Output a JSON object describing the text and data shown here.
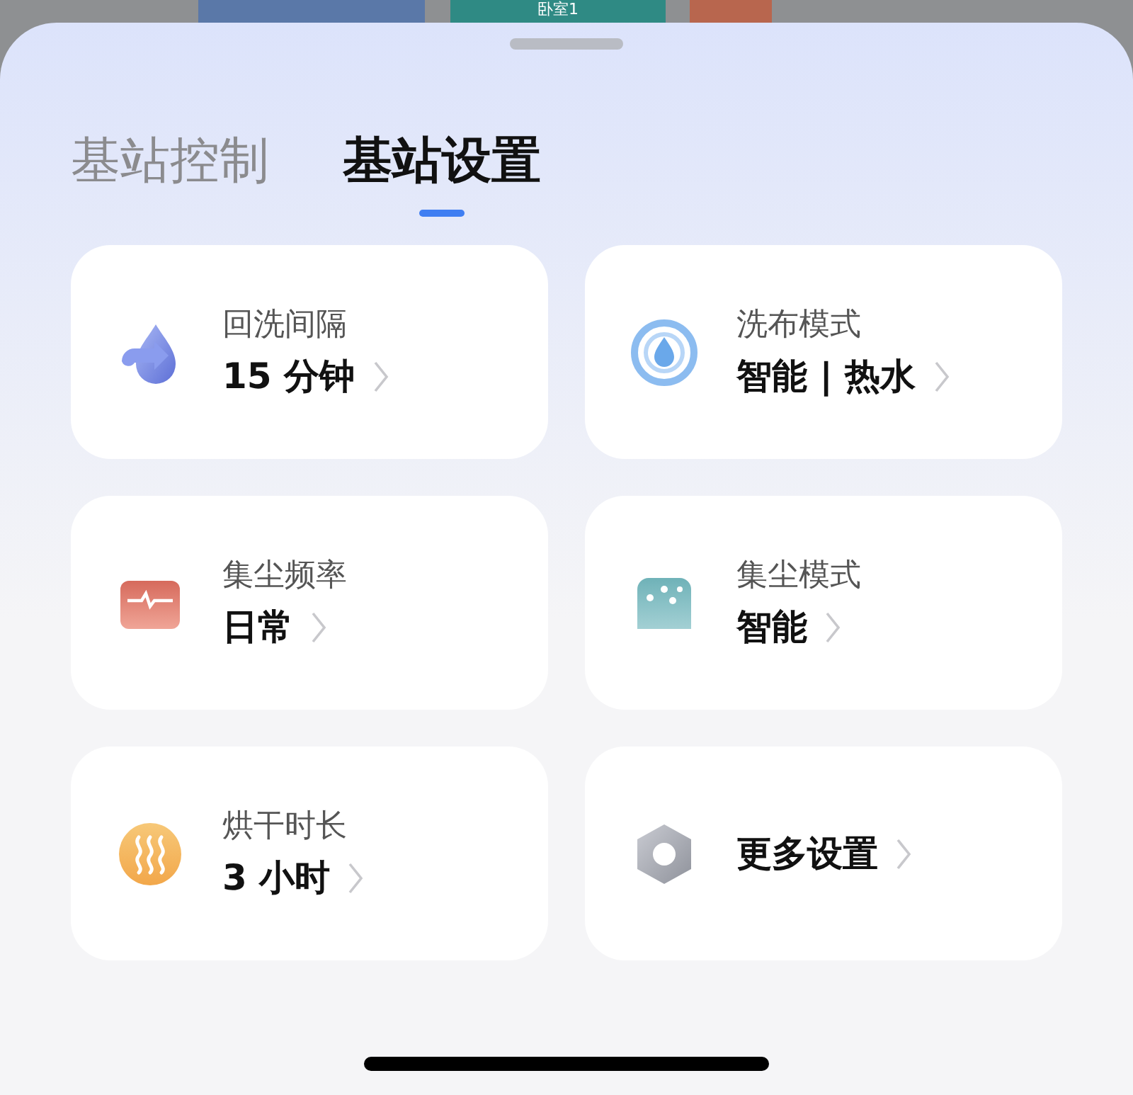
{
  "map": {
    "rooms": [
      {
        "color": "#5a78a8"
      },
      {
        "color": "#2f8a84",
        "label": "卧室1"
      },
      {
        "color": "#b8664e"
      }
    ]
  },
  "tabs": [
    {
      "label": "基站控制",
      "selected": false
    },
    {
      "label": "基站设置",
      "selected": true
    }
  ],
  "cards": [
    {
      "kind": "drop",
      "title": "回洗间隔",
      "value": "15 分钟"
    },
    {
      "kind": "swirl",
      "title": "洗布模式",
      "value": "智能 | 热水"
    },
    {
      "kind": "box-pulse",
      "title": "集尘频率",
      "value": "日常"
    },
    {
      "kind": "box-dots",
      "title": "集尘模式",
      "value": "智能"
    },
    {
      "kind": "steam",
      "title": "烘干时长",
      "value": "3 小时"
    },
    {
      "kind": "hex",
      "value": "更多设置"
    }
  ]
}
